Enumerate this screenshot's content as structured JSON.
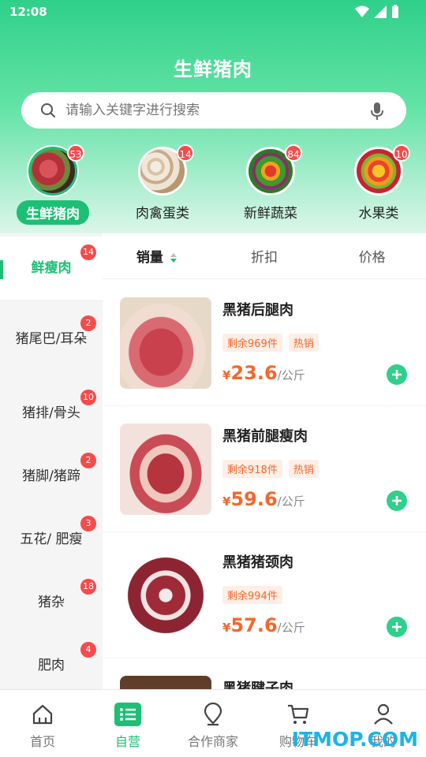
{
  "status_bar": {
    "time": "12:08"
  },
  "header": {
    "title": "生鲜猪肉",
    "search_placeholder": "请输入关键字进行搜索"
  },
  "categories": [
    {
      "label": "生鲜猪肉",
      "badge": "53",
      "active": true
    },
    {
      "label": "肉禽蛋类",
      "badge": "14"
    },
    {
      "label": "新鲜蔬菜",
      "badge": "84"
    },
    {
      "label": "水果类",
      "badge": "10"
    }
  ],
  "sidebar": [
    {
      "label": "鲜瘦肉",
      "badge": "14",
      "active": true
    },
    {
      "label": "猪尾巴/耳朵",
      "badge": "2"
    },
    {
      "label": "猪排/骨头",
      "badge": "10"
    },
    {
      "label": "猪脚/猪蹄",
      "badge": "2"
    },
    {
      "label": "五花/ 肥瘦",
      "badge": "3"
    },
    {
      "label": "猪杂",
      "badge": "18"
    },
    {
      "label": "肥肉",
      "badge": "4"
    }
  ],
  "sort": {
    "sales": "销量",
    "discount": "折扣",
    "price": "价格"
  },
  "products": [
    {
      "name": "黑猪后腿肉",
      "stock": "剩余969件",
      "hot": "热销",
      "currency": "¥",
      "price": "23.6",
      "unit": "/公斤"
    },
    {
      "name": "黑猪前腿瘦肉",
      "stock": "剩余918件",
      "hot": "热销",
      "currency": "¥",
      "price": "59.6",
      "unit": "/公斤"
    },
    {
      "name": "黑猪猪颈肉",
      "stock": "剩余994件",
      "currency": "¥",
      "price": "57.6",
      "unit": "/公斤"
    },
    {
      "name": "黑猪腱子肉"
    }
  ],
  "bottom_nav": {
    "home": "首页",
    "self_run": "自营",
    "partners": "合作商家",
    "cart": "购物车",
    "mine": "我的"
  },
  "watermark": "ITMOP.COM",
  "colors": {
    "accent": "#1dbf75",
    "price": "#f2682c",
    "badge": "#f44b4b"
  }
}
